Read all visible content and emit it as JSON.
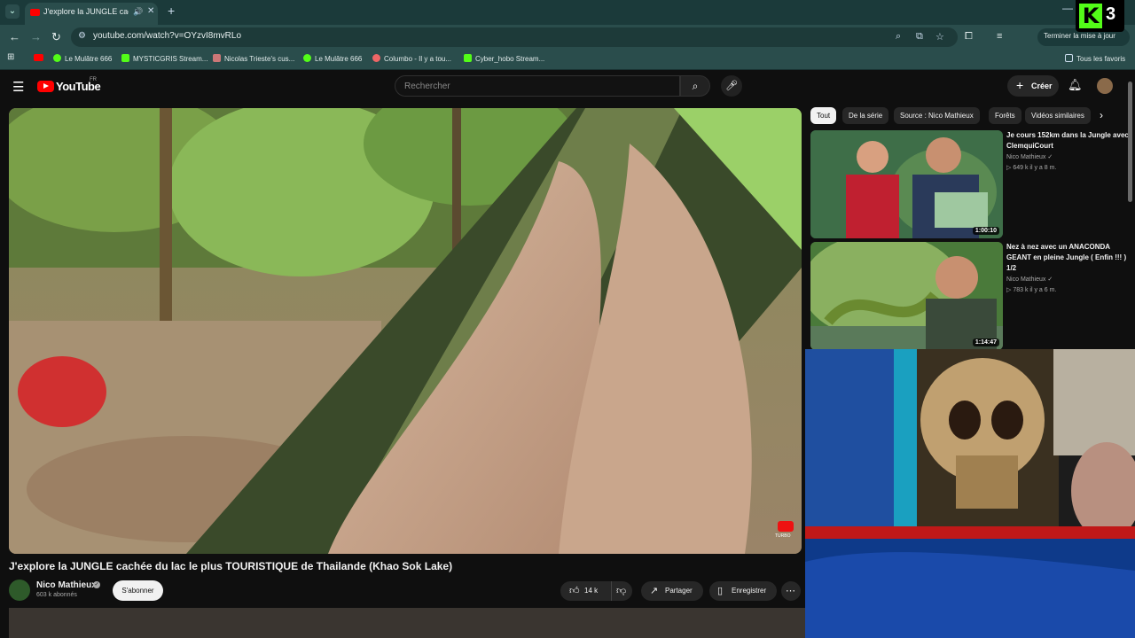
{
  "browser": {
    "tab_title": "J'explore la JUNGLE cachée",
    "url": "youtube.com/watch?v=OYzvI8mvRLo",
    "update_button": "Terminer la mise à jour",
    "bookmarks": [
      {
        "label": "",
        "color": "#ff0000"
      },
      {
        "label": "Le Mulâtre 666",
        "color": "#53fc18"
      },
      {
        "label": "MYSTICGRIS Stream...",
        "color": "#53fc18"
      },
      {
        "label": "Nicolas Trieste's cus...",
        "color": "#c77"
      },
      {
        "label": "Le Mulâtre 666",
        "color": "#53fc18"
      },
      {
        "label": "Columbo - Il y a tou...",
        "color": "#e66"
      },
      {
        "label": "Cyber_hobo Stream...",
        "color": "#53fc18"
      }
    ],
    "all_bookmarks": "Tous les favoris"
  },
  "overlay": {
    "kick_number": "3",
    "kick_letter": "K"
  },
  "youtube": {
    "wordmark": "YouTube",
    "country": "FR",
    "search_placeholder": "Rechercher",
    "create_label": "Créer",
    "video": {
      "title": "J'explore la JUNGLE cachée du lac le plus TOURISTIQUE de Thailande (Khao Sok Lake)",
      "channel": "Nico Mathieux",
      "subscribers": "603 k abonnés",
      "subscribe": "S'abonner",
      "likes": "14 k",
      "share": "Partager",
      "save": "Enregistrer",
      "watermark": "TURBO"
    },
    "chips": [
      "Tout",
      "De la série",
      "Source : Nico Mathieux",
      "Forêts",
      "Vidéos similaires"
    ],
    "recommendations": [
      {
        "title": "Je cours 152km dans la Jungle avec ClemquiCourt",
        "channel": "Nico Mathieux",
        "meta": "649 k   il y a 8 m.",
        "duration": "1:00:10"
      },
      {
        "title": "Nez à nez avec un ANACONDA GEANT en pleine Jungle ( Enfin !!! ) 1/2",
        "channel": "Nico Mathieux",
        "meta": "783 k   il y a 6 m.",
        "duration": "1:14:47"
      }
    ]
  },
  "colors": {
    "accent": "#ff0000",
    "kick": "#53fc18",
    "chrome": "#2a4d4c"
  }
}
